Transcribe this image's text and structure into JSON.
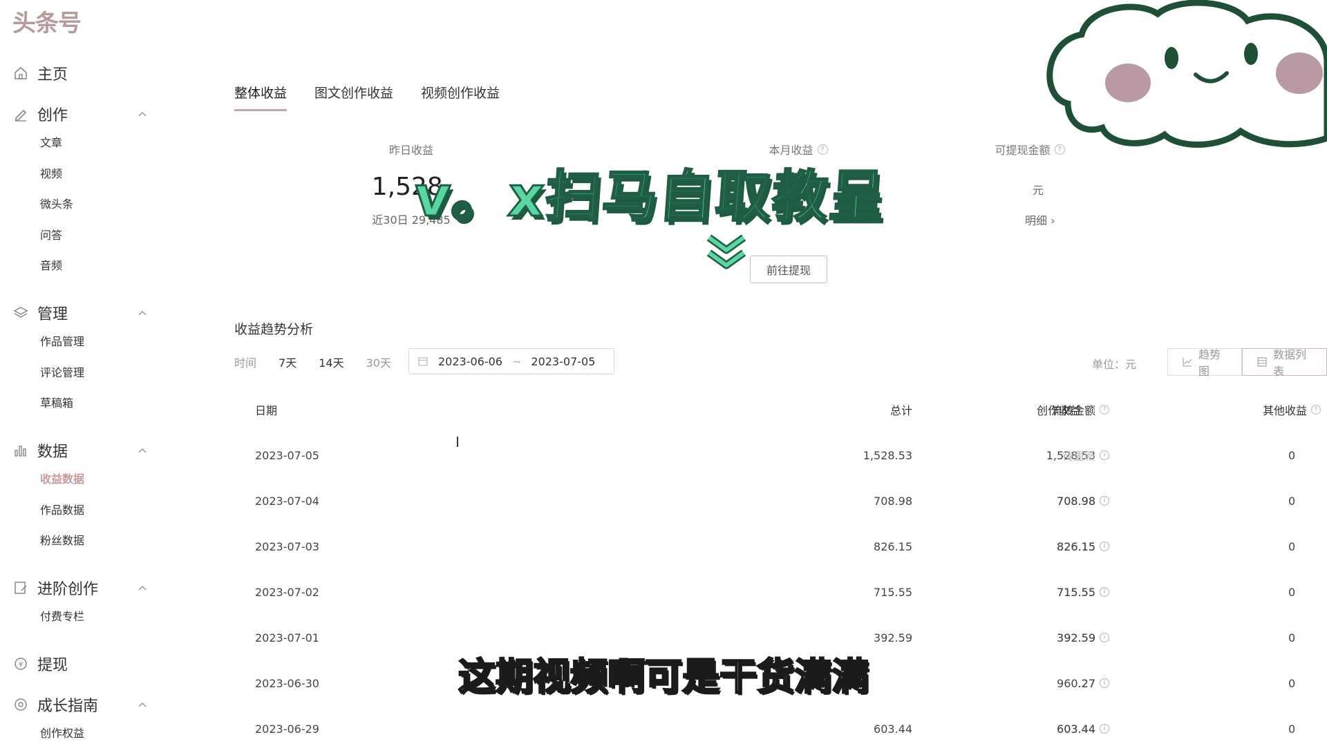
{
  "logo": "头条号",
  "sidebar": {
    "home": "主页",
    "create": {
      "label": "创作",
      "items": [
        "文章",
        "视频",
        "微头条",
        "问答",
        "音频"
      ]
    },
    "manage": {
      "label": "管理",
      "items": [
        "作品管理",
        "评论管理",
        "草稿箱"
      ]
    },
    "data": {
      "label": "数据",
      "items": [
        "收益数据",
        "作品数据",
        "粉丝数据"
      ]
    },
    "advanced": {
      "label": "进阶创作",
      "items": [
        "付费专栏"
      ]
    },
    "withdraw": "提现",
    "growth": {
      "label": "成长指南",
      "items": [
        "创作权益"
      ]
    }
  },
  "tabs": [
    "整体收益",
    "图文创作收益",
    "视频创作收益"
  ],
  "stats": {
    "yesterday_label": "昨日收益",
    "yesterday_value": "1,528.",
    "yesterday_sub": "近30日 29,485",
    "month_label": "本月收益",
    "withdrawable_label": "可提现金额",
    "withdrawable_unit": "元",
    "withdrawable_link": "明细 ›",
    "withdraw_button": "前往提现"
  },
  "overlay": {
    "banner": "v。x扫马自取教呈",
    "subtitle": "这期视频啊可是干货满满"
  },
  "trend": {
    "title": "收益趋势分析",
    "time_label": "时间",
    "ranges": [
      "7天",
      "14天",
      "30天"
    ],
    "date_start": "2023-06-06",
    "date_sep": "~",
    "date_end": "2023-07-05",
    "unit": "单位：元",
    "view_trend": "趋势图",
    "view_table": "数据列表"
  },
  "table": {
    "headers": [
      "日期",
      "总计",
      "流转金额",
      "创作收益",
      "其他收益"
    ],
    "rows": [
      {
        "date": "2023-07-05",
        "total": "1,528.53",
        "flow": "1,528.53",
        "creation": "待更新",
        "other": "0"
      },
      {
        "date": "2023-07-04",
        "total": "708.98",
        "flow": "708.98",
        "creation": "708.98",
        "other": "0"
      },
      {
        "date": "2023-07-03",
        "total": "826.15",
        "flow": "826.15",
        "creation": "826.15",
        "other": "0"
      },
      {
        "date": "2023-07-02",
        "total": "715.55",
        "flow": "715.55",
        "creation": "715.55",
        "other": "0"
      },
      {
        "date": "2023-07-01",
        "total": "392.59",
        "flow": "392.59",
        "creation": "392.59",
        "other": "0"
      },
      {
        "date": "2023-06-30",
        "total": "",
        "flow": ".27",
        "creation": "960.27",
        "other": "0"
      },
      {
        "date": "2023-06-29",
        "total": "603.44",
        "flow": "603.44",
        "creation": "603.44",
        "other": "0"
      }
    ]
  },
  "colors": {
    "accent": "#c0a6a6",
    "banner_green": "#59d6a2",
    "cloud_stroke": "#1f4f36"
  }
}
